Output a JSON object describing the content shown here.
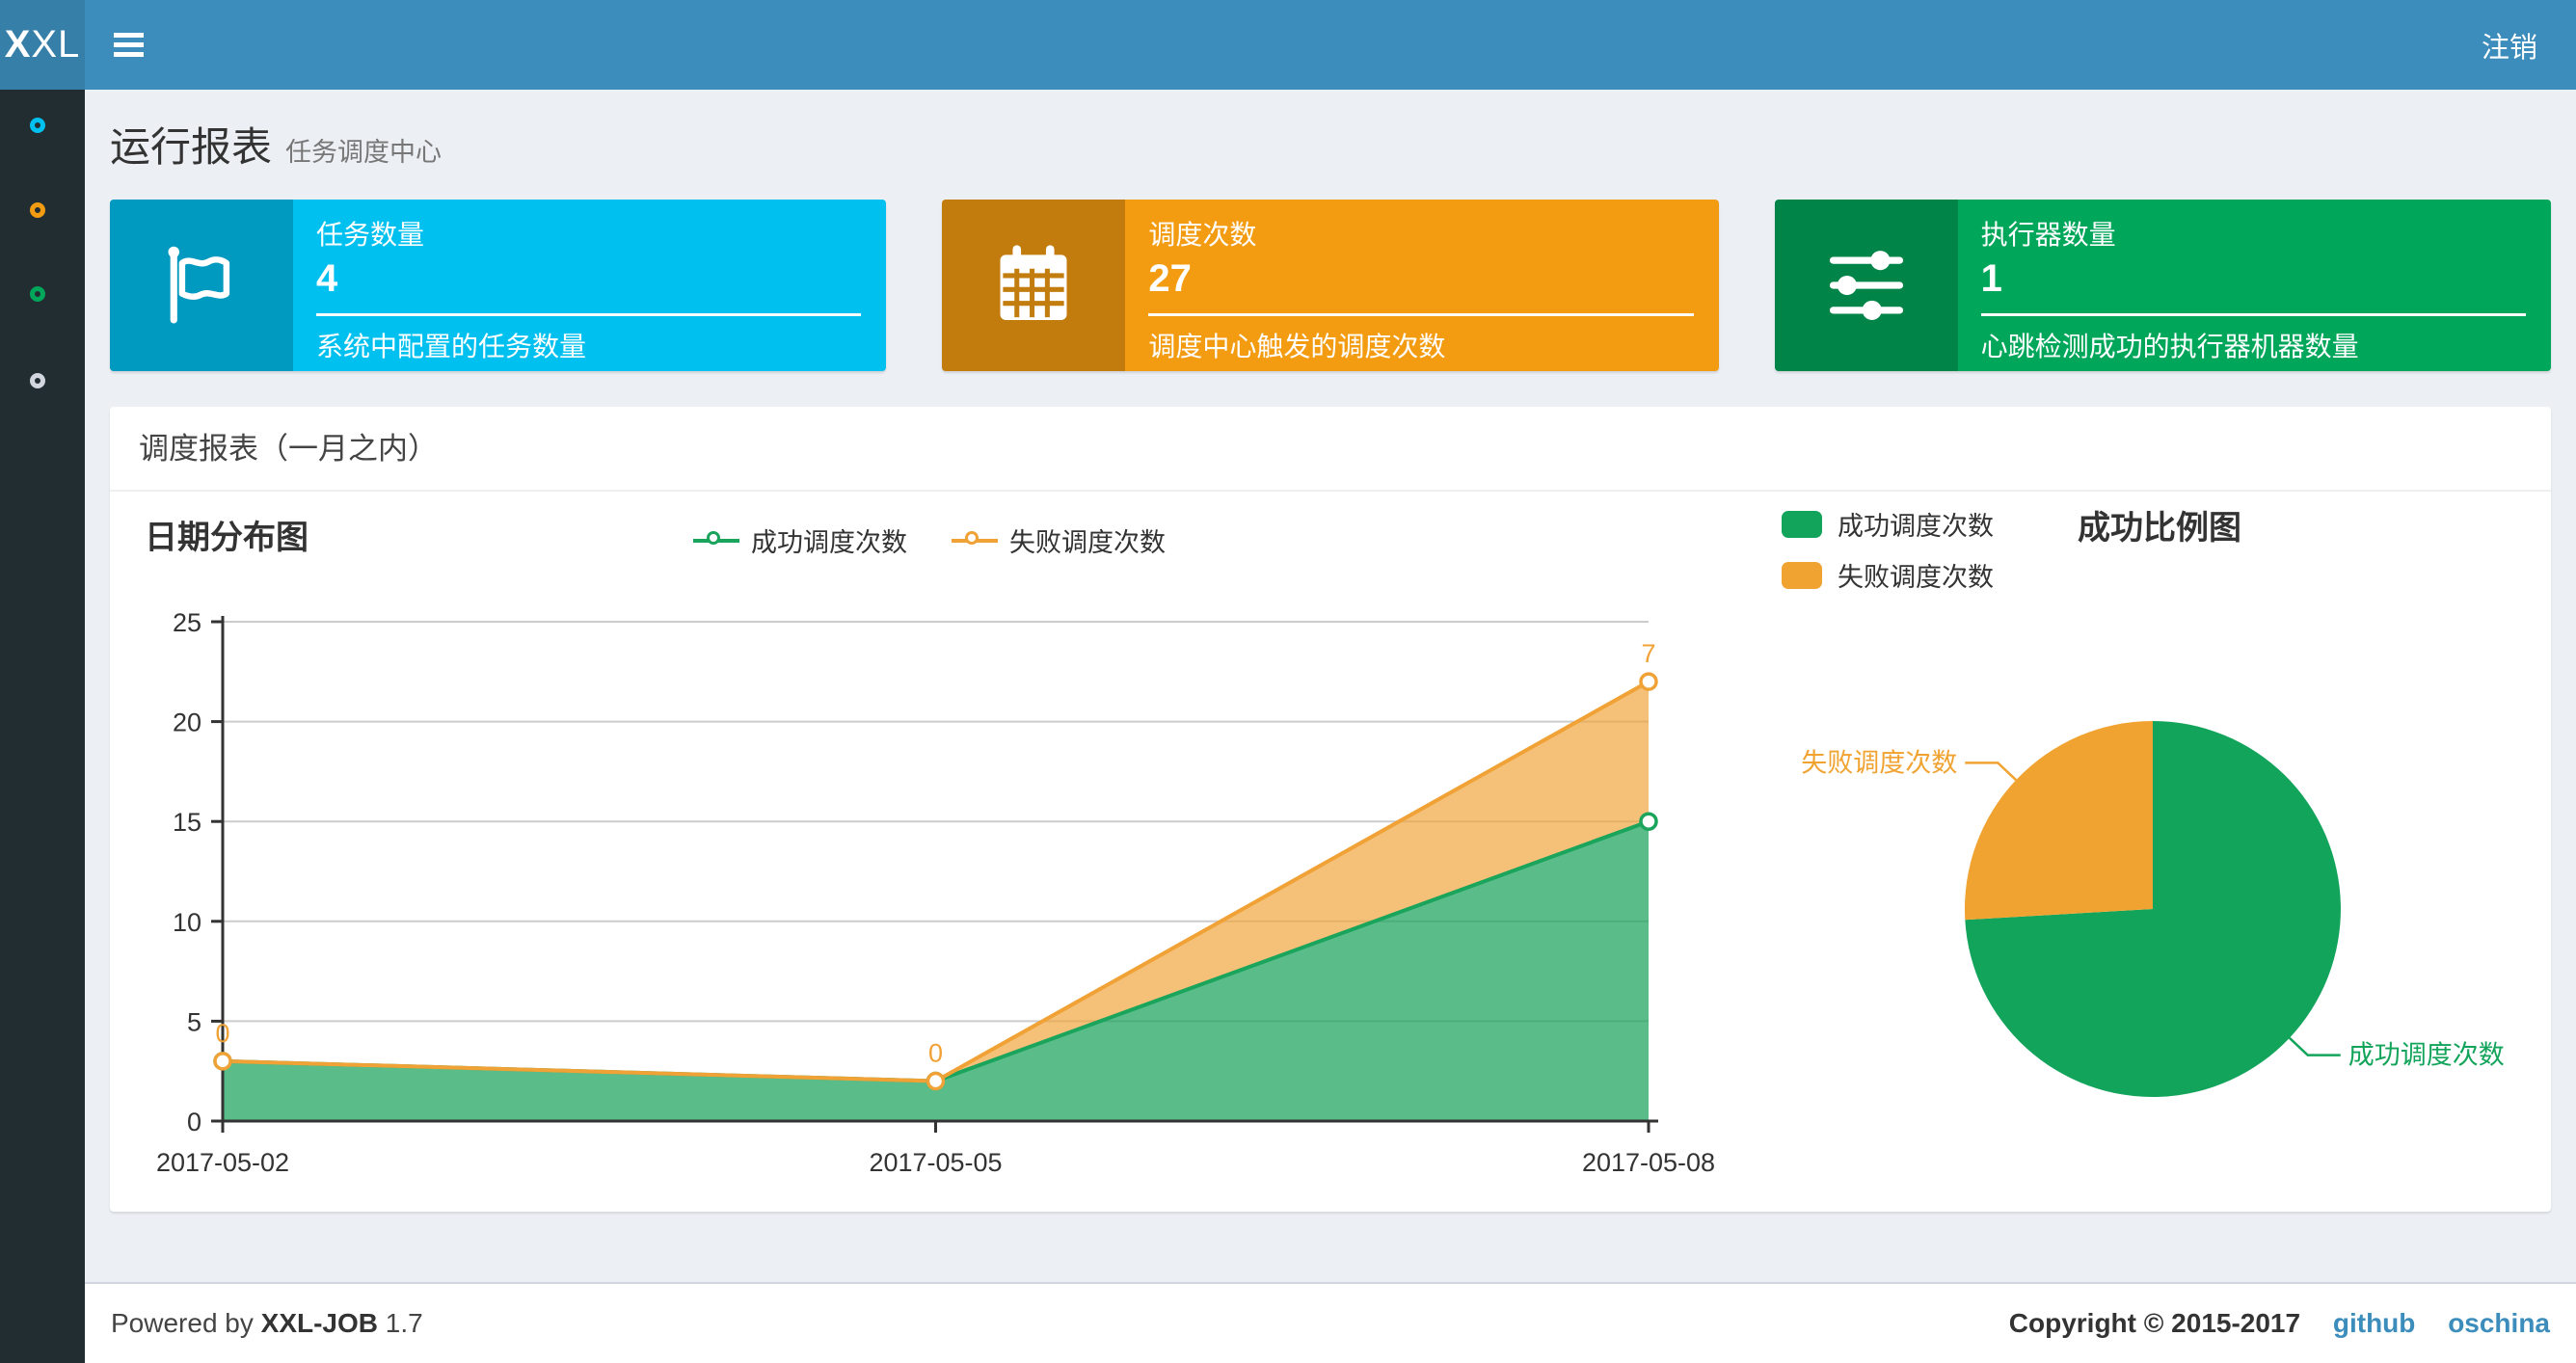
{
  "theme": {
    "navbar_bg": "#3c8dbc",
    "logo_bg": "#367fa9",
    "sidebar_bg": "#222d32",
    "content_bg": "#ecf0f5",
    "link_color": "#3c8dbc"
  },
  "navbar": {
    "logo_bold": "X",
    "logo_rest": "XL",
    "logout": "注销"
  },
  "sidebar": {
    "items": [
      {
        "name": "report",
        "color": "#00c0ef"
      },
      {
        "name": "job",
        "color": "#f39c12"
      },
      {
        "name": "log",
        "color": "#00a65a"
      },
      {
        "name": "help",
        "color": "#d2d6de"
      }
    ]
  },
  "page": {
    "title": "运行报表",
    "subtitle": "任务调度中心"
  },
  "info_boxes": [
    {
      "icon": "flag",
      "label": "任务数量",
      "value": "4",
      "desc": "系统中配置的任务数量",
      "bg": "#00c0ef",
      "icon_bg": "#009abf"
    },
    {
      "icon": "calendar",
      "label": "调度次数",
      "value": "27",
      "desc": "调度中心触发的调度次数",
      "bg": "#f39c12",
      "icon_bg": "#c27d0e"
    },
    {
      "icon": "sliders",
      "label": "执行器数量",
      "value": "1",
      "desc": "心跳检测成功的执行器机器数量",
      "bg": "#00a65a",
      "icon_bg": "#008548"
    }
  ],
  "panel": {
    "title": "调度报表（一月之内）"
  },
  "chart_data": [
    {
      "type": "area",
      "title": "日期分布图",
      "stacked": true,
      "grid": true,
      "legend_position": "top-center",
      "categories": [
        "2017-05-02",
        "2017-05-05",
        "2017-05-08"
      ],
      "ylim": [
        0,
        25
      ],
      "yticks": [
        0,
        5,
        10,
        15,
        20,
        25
      ],
      "series": [
        {
          "name": "成功调度次数",
          "color": "#1aa45c",
          "fill": "rgba(26,164,92,0.72)",
          "values": [
            3,
            2,
            15
          ]
        },
        {
          "name": "失败调度次数",
          "color": "#f0a236",
          "fill": "rgba(240,162,54,0.68)",
          "values": [
            0,
            0,
            7
          ]
        }
      ],
      "point_labels": {
        "series": "失败调度次数",
        "values": [
          0,
          0,
          7
        ]
      }
    },
    {
      "type": "pie",
      "title": "成功比例图",
      "legend_position": "top-left",
      "total": 27,
      "slices": [
        {
          "name": "成功调度次数",
          "value": 20,
          "color": "#13a45b"
        },
        {
          "name": "失败调度次数",
          "value": 7,
          "color": "#f0a331"
        }
      ]
    }
  ],
  "footer": {
    "powered": "Powered by",
    "brand": "XXL-JOB",
    "version": "1.7",
    "copyright": "Copyright © 2015-2017",
    "links": [
      {
        "label": "github"
      },
      {
        "label": "oschina"
      }
    ]
  }
}
